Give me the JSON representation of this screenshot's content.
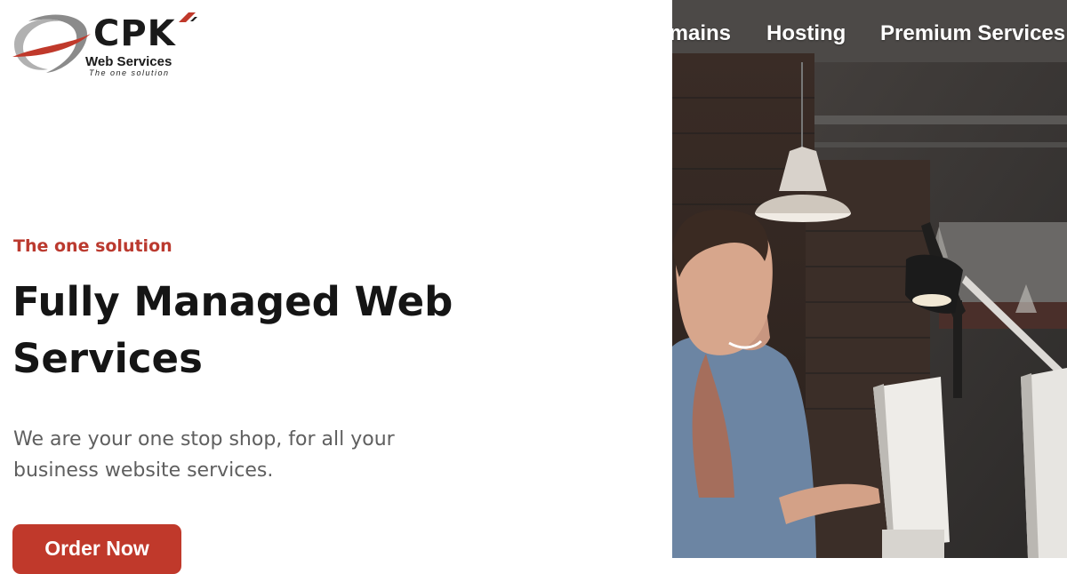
{
  "logo": {
    "name": "CPK",
    "subtitle": "Web Services",
    "tagline": "The one solution"
  },
  "hero": {
    "eyebrow": "The one solution",
    "headline": "Fully Managed Web Services",
    "description": "We are your one stop shop, for all your business website services.",
    "cta_label": "Order Now"
  },
  "nav": {
    "items": [
      {
        "label": "Domains",
        "visible_text": "mains"
      },
      {
        "label": "Hosting"
      },
      {
        "label": "Premium Services"
      }
    ]
  },
  "colors": {
    "accent": "#c0392b",
    "eyebrow": "#bb3a2f",
    "headline": "#151515",
    "body_text": "#5f5f5f",
    "nav_text": "#ffffff"
  },
  "icons": {
    "logo_mark": "swoosh-logo-icon",
    "logo_accent": "red-diagonal-mark-icon"
  }
}
